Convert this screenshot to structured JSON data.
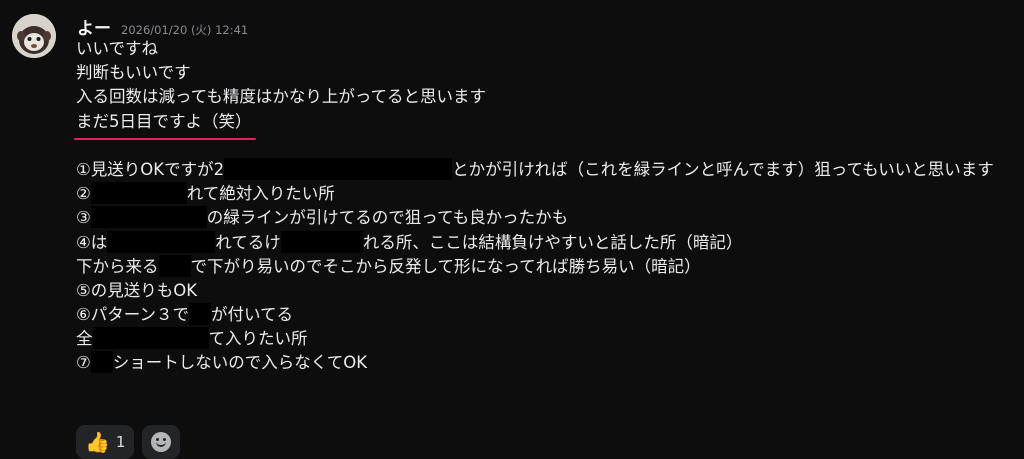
{
  "message": {
    "author": "よー",
    "timestamp": "2026/01/20 (火) 12:41",
    "avatar_icon": "monkey-avatar",
    "lines": {
      "l1": "いいですね",
      "l2": "判断もいいです",
      "l3": "入る回数は減っても精度はかなり上がってると思います",
      "l4": "まだ5日目ですよ（笑）",
      "l5a": "①見送りOKですが2",
      "l5b": "とかが引ければ（これを緑ラインと呼んでます）狙ってもいいと思います",
      "l6a": "②",
      "l6b": "れて絶対入りたい所",
      "l7a": "③",
      "l7b": "の緑ラインが引けてるので狙っても良かったかも",
      "l8a": "④は",
      "l8b": "れてるけ",
      "l8c": "れる所、ここは結構負けやすいと話した所（暗記）",
      "l9a": "下から来る",
      "l9b": "で下がり易いのでそこから反発して形になってれば勝ち易い（暗記）",
      "l10": "⑤の見送りもOK",
      "l11a": "⑥パターン３で",
      "l11b": "が付いてる",
      "l12a": "全",
      "l12b": "て入りたい所",
      "l13a": "⑦",
      "l13b": "ショートしないので入らなくてOK"
    }
  },
  "reactions": {
    "thumbs_emoji": "👍",
    "thumbs_count": "1",
    "add_icon": "add-reaction-smiley-icon"
  },
  "colors": {
    "background": "#0d0d0e",
    "underline": "#e0245e",
    "redaction": "#000000"
  }
}
